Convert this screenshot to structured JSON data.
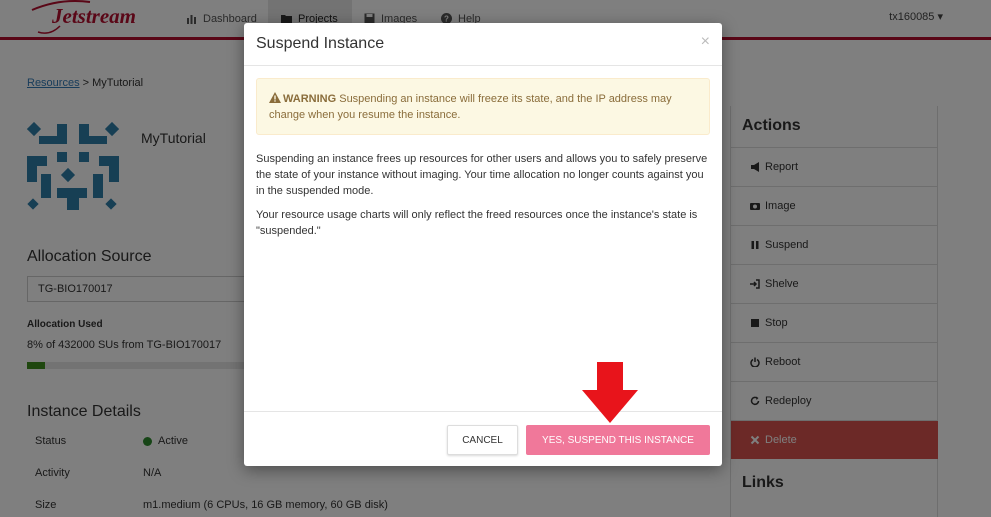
{
  "nav": {
    "logo_text": "Jetstream",
    "items": [
      {
        "label": "Dashboard",
        "icon": "bar-chart-icon"
      },
      {
        "label": "Projects",
        "icon": "folder-icon"
      },
      {
        "label": "Images",
        "icon": "floppy-disk-icon"
      },
      {
        "label": "Help",
        "icon": "question-circle-icon"
      }
    ],
    "active_item": "Projects",
    "username": "tx160085 ▾"
  },
  "breadcrumb": {
    "link": "Resources",
    "separator": ">",
    "current": "MyTutorial"
  },
  "instance": {
    "name": "MyTutorial"
  },
  "allocation": {
    "title": "Allocation Source",
    "selected": "TG-BIO170017",
    "used_label": "Allocation Used",
    "used_text": "8% of 432000 SUs from TG-BIO170017",
    "used_fraction": 0.08
  },
  "instance_details": {
    "title": "Instance Details",
    "rows": [
      {
        "label": "Status",
        "value": "Active"
      },
      {
        "label": "Activity",
        "value": "N/A"
      },
      {
        "label": "Size",
        "value": "m1.medium (6 CPUs, 16 GB memory, 60 GB disk)"
      }
    ]
  },
  "actions": {
    "title": "Actions",
    "items": [
      {
        "label": "Report",
        "icon": "bullhorn-icon"
      },
      {
        "label": "Image",
        "icon": "camera-icon"
      },
      {
        "label": "Suspend",
        "icon": "pause-icon"
      },
      {
        "label": "Shelve",
        "icon": "log-in-icon"
      },
      {
        "label": "Stop",
        "icon": "stop-icon"
      },
      {
        "label": "Reboot",
        "icon": "power-icon"
      },
      {
        "label": "Redeploy",
        "icon": "refresh-icon"
      },
      {
        "label": "Delete",
        "icon": "remove-icon"
      }
    ],
    "links_title": "Links"
  },
  "modal": {
    "title": "Suspend Instance",
    "close": "×",
    "warning_label": "WARNING",
    "warning_text": " Suspending an instance will freeze its state, and the IP address may change when you resume the instance.",
    "paragraph1": "Suspending an instance frees up resources for other users and allows you to safely preserve the state of your instance without imaging. Your time allocation no longer counts against you in the suspended mode.",
    "paragraph2": "Your resource usage charts will only reflect the freed resources once the instance's state is \"suspended.\"",
    "cancel_label": "CANCEL",
    "confirm_label": "YES, SUSPEND THIS INSTANCE"
  },
  "colors": {
    "brand": "#b50e2f",
    "confirm": "#f0789a",
    "danger": "#d9534f",
    "warning_bg": "#fcf8e3",
    "arrow": "#e8141b"
  }
}
